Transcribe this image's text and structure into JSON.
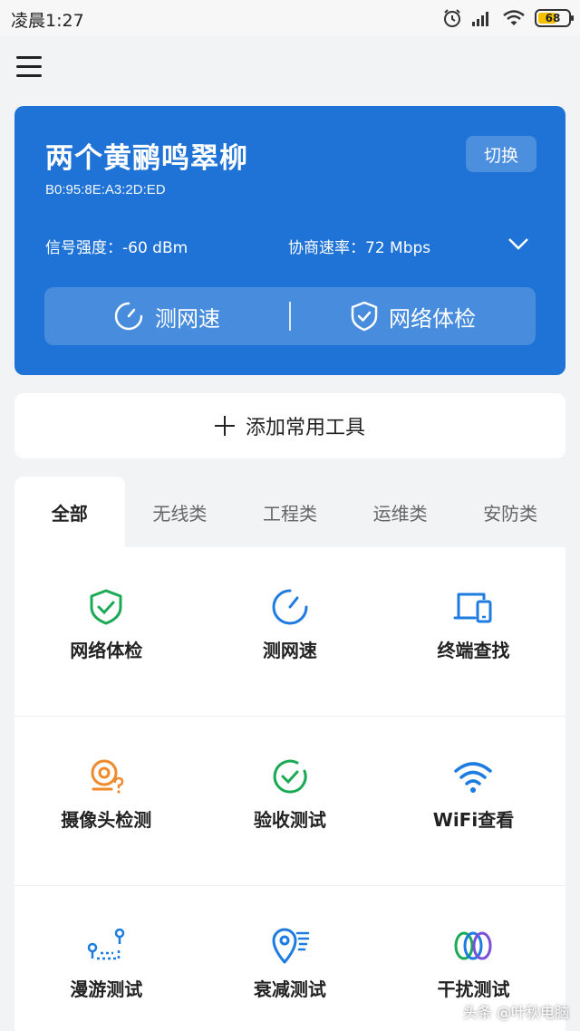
{
  "status_bar": {
    "time": "凌晨1:27",
    "battery": "68",
    "battery_level": 0.68
  },
  "card": {
    "ssid": "两个黄鹂鸣翠柳",
    "mac": "B0:95:8E:A3:2D:ED",
    "switch_label": "切换",
    "signal": "信号强度：-60 dBm",
    "rate": "协商速率：72 Mbps",
    "speed_test_label": "测网速",
    "network_check_label": "网络体检"
  },
  "add_tool_label": "添加常用工具",
  "tabs": [
    {
      "label": "全部",
      "active": true
    },
    {
      "label": "无线类",
      "active": false
    },
    {
      "label": "工程类",
      "active": false
    },
    {
      "label": "运维类",
      "active": false
    },
    {
      "label": "安防类",
      "active": false
    }
  ],
  "tools": [
    {
      "label": "网络体检",
      "icon": "shield-check-icon"
    },
    {
      "label": "测网速",
      "icon": "speedometer-icon"
    },
    {
      "label": "终端查找",
      "icon": "devices-icon"
    },
    {
      "label": "摄像头检测",
      "icon": "camera-question-icon"
    },
    {
      "label": "验收测试",
      "icon": "check-circle-icon"
    },
    {
      "label": "WiFi查看",
      "icon": "wifi-icon"
    },
    {
      "label": "漫游测试",
      "icon": "roaming-icon"
    },
    {
      "label": "衰减测试",
      "icon": "location-signal-icon"
    },
    {
      "label": "干扰测试",
      "icon": "interference-rings-icon"
    }
  ],
  "watermark": "头条 @叶秋电脑",
  "colors": {
    "card_blue": "#1f73d6",
    "green": "#1aaa55",
    "blue": "#1e7be0",
    "orange": "#f08a2c",
    "purple": "#7b4fd8"
  }
}
